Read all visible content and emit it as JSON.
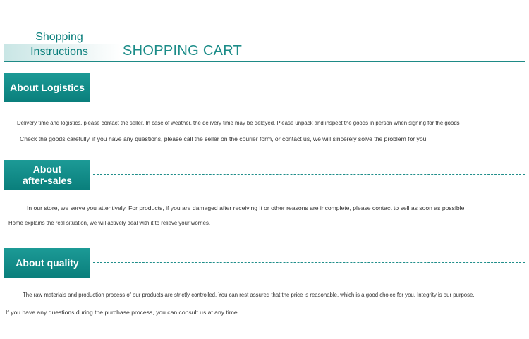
{
  "header": {
    "small_title_line1": "Shopping",
    "small_title_line2": "Instructions",
    "large_title": "SHOPPING CART"
  },
  "sections": [
    {
      "label_line1": "About Logistics",
      "label_line2": "",
      "lines": [
        "Delivery time and logistics, please contact the seller. In case of weather, the delivery time may be delayed. Please unpack and inspect the goods in person when signing for the goods",
        "Check the goods carefully, if you have any questions, please call the seller on the courier form, or contact us, we will sincerely solve the problem for you."
      ]
    },
    {
      "label_line1": "About",
      "label_line2": "after-sales",
      "lines": [
        "In our store, we serve you attentively. For products, if you are damaged after receiving it or other reasons are incomplete, please contact to sell as soon as possible",
        "Home explains the real situation, we will actively deal with it to relieve your worries."
      ]
    },
    {
      "label_line1": "About quality",
      "label_line2": "",
      "lines": [
        "The raw materials and production process of our products are strictly controlled. You can rest assured that the price is reasonable, which is a good choice for you. Integrity is our purpose,",
        "If you have any questions during the purchase process, you can consult us at any time."
      ]
    }
  ],
  "colors": {
    "accent": "#0a7f7c",
    "accent_light": "#1c9a96",
    "text": "#333333"
  }
}
